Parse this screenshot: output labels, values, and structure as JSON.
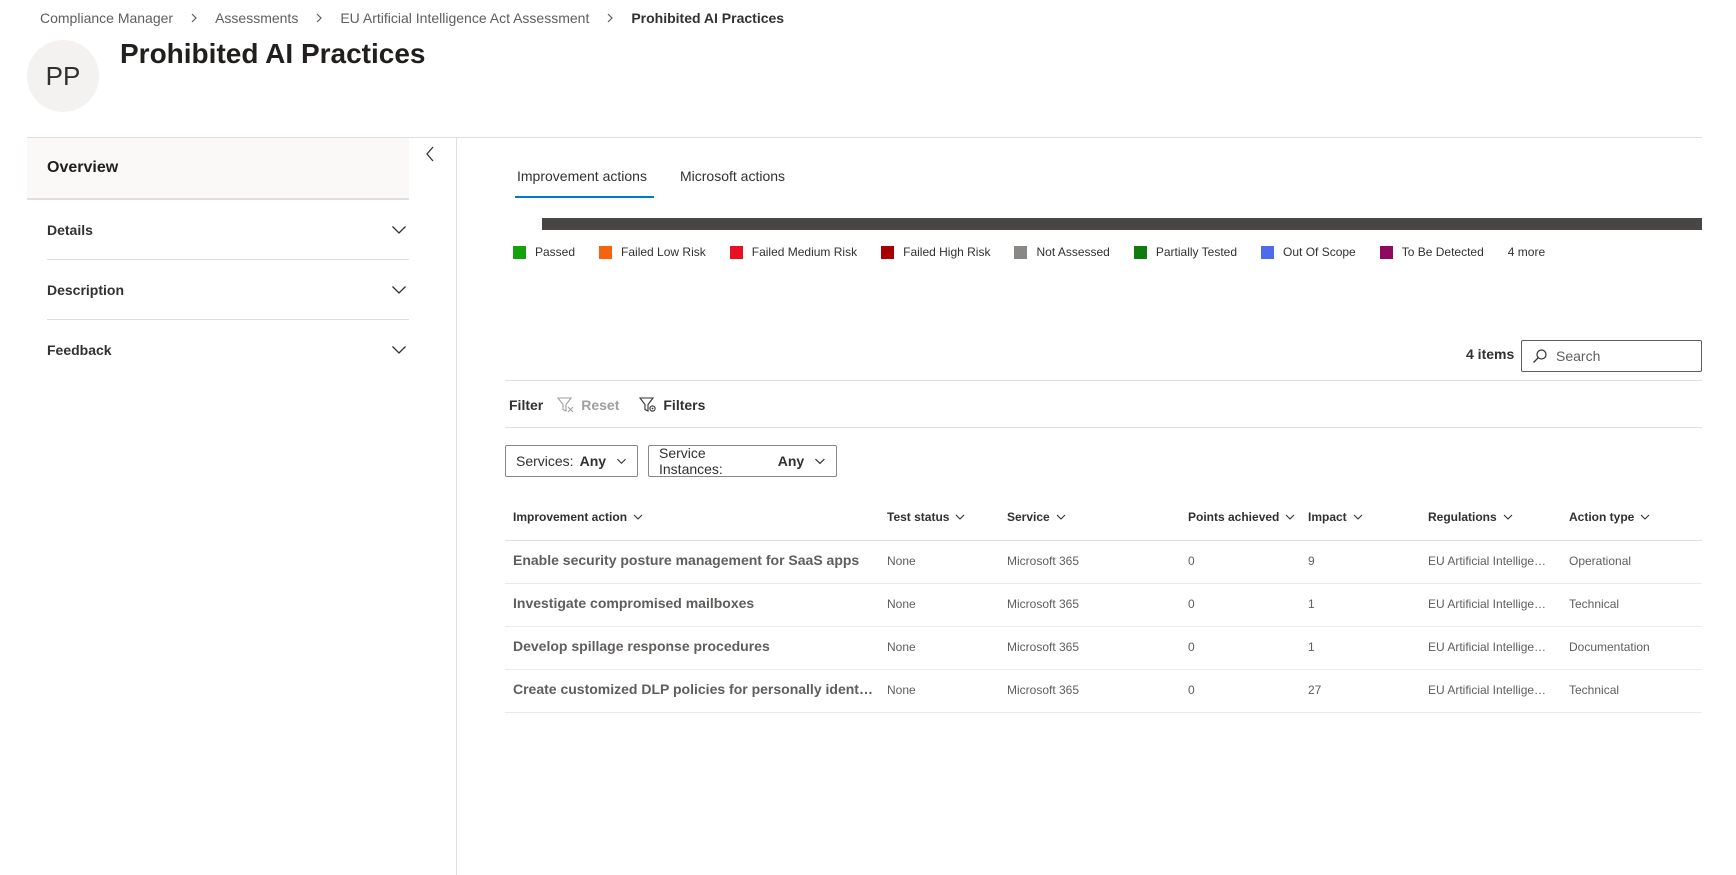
{
  "breadcrumb": {
    "items": [
      "Compliance Manager",
      "Assessments",
      "EU Artificial Intelligence Act Assessment",
      "Prohibited AI Practices"
    ]
  },
  "header": {
    "avatar_initials": "PP",
    "title": "Prohibited AI Practices"
  },
  "sidebar": {
    "overview_label": "Overview",
    "sections": [
      {
        "label": "Details"
      },
      {
        "label": "Description"
      },
      {
        "label": "Feedback"
      }
    ]
  },
  "tabs": {
    "improvement": "Improvement actions",
    "microsoft": "Microsoft actions",
    "accent_color": "#0078d4"
  },
  "status_bar": {
    "color": "#484644"
  },
  "legend": {
    "items": [
      {
        "label": "Passed",
        "color": "#13a10e"
      },
      {
        "label": "Failed Low Risk",
        "color": "#f7630c"
      },
      {
        "label": "Failed Medium Risk",
        "color": "#e81123"
      },
      {
        "label": "Failed High Risk",
        "color": "#a80000"
      },
      {
        "label": "Not Assessed",
        "color": "#8a8886"
      },
      {
        "label": "Partially Tested",
        "color": "#107c10"
      },
      {
        "label": "Out Of Scope",
        "color": "#4f6bed"
      },
      {
        "label": "To Be Detected",
        "color": "#8e0a5f"
      }
    ],
    "more_label": "4 more"
  },
  "list": {
    "item_count": "4 items",
    "search_placeholder": "Search"
  },
  "filter": {
    "label": "Filter",
    "reset_label": "Reset",
    "filters_label": "Filters"
  },
  "dropdowns": {
    "services_label": "Services:",
    "services_value": "Any",
    "instances_label": "Service Instances:",
    "instances_value": "Any"
  },
  "table": {
    "columns": {
      "action": "Improvement action",
      "test_status": "Test status",
      "service": "Service",
      "points": "Points achieved",
      "impact": "Impact",
      "regulations": "Regulations",
      "action_type": "Action type"
    },
    "rows": [
      {
        "action": "Enable security posture management for SaaS apps",
        "test_status": "None",
        "service": "Microsoft 365",
        "points": "0",
        "impact": "9",
        "regulations": "EU Artificial Intelligence Act",
        "action_type": "Operational"
      },
      {
        "action": "Investigate compromised mailboxes",
        "test_status": "None",
        "service": "Microsoft 365",
        "points": "0",
        "impact": "1",
        "regulations": "EU Artificial Intelligence Act",
        "action_type": "Technical"
      },
      {
        "action": "Develop spillage response procedures",
        "test_status": "None",
        "service": "Microsoft 365",
        "points": "0",
        "impact": "1",
        "regulations": "EU Artificial Intelligence Act",
        "action_type": "Documentation"
      },
      {
        "action": "Create customized DLP policies for personally identifiable information",
        "test_status": "None",
        "service": "Microsoft 365",
        "points": "0",
        "impact": "27",
        "regulations": "EU Artificial Intelligence Act",
        "action_type": "Technical"
      }
    ]
  }
}
